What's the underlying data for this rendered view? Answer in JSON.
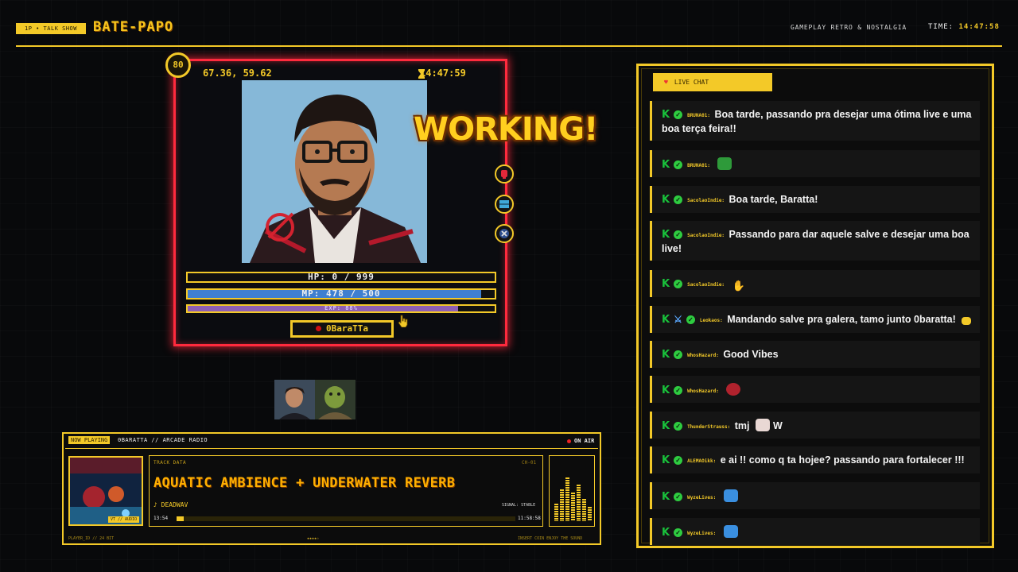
{
  "header": {
    "mode_tag": "1P • TALK SHOW",
    "title": "BATE-PAPO",
    "subtitle": "GAMEPLAY RETRO & NOSTALGIA",
    "time_label": "TIME:",
    "time_value": "14:47:58"
  },
  "card": {
    "level": "80",
    "coords": "67.36, 59.62",
    "clock": "14:47:59",
    "status_overlay": "WORKING!",
    "hp_label": "HP: 0 / 999",
    "hp_fraction": 0,
    "mp_label": "MP: 478 / 500",
    "mp_fraction": 0.956,
    "exp_label": "EXP: 88%",
    "exp_fraction": 0.88,
    "player_name": "0BaraTTa"
  },
  "radio": {
    "now_playing_tag": "NOW PLAYING",
    "station": "0BARATTA // ARCADE RADIO",
    "on_air": "ON AIR",
    "album_tag": "VT // AUDIO",
    "track_data_label": "TRACK DATA",
    "channel": "CH-01",
    "track_title": "AQUATIC AMBIENCE + UNDERWATER REVERB",
    "artist": "♪ DEADWAV",
    "signal": "SIGNAL: STABLE",
    "time_start": "13:54",
    "time_end": "11:58:58",
    "progress_fraction": 0.02,
    "footer_left": "PLAYER_ID // 24 BIT",
    "footer_center": "★★★★☆",
    "footer_right": "INSERT COIN   ENJOY THE SOUND"
  },
  "chat": {
    "header": "LIVE CHAT",
    "messages": [
      {
        "user": "BRUNA01:",
        "text": "Boa tarde, passando pra desejar uma ótima live e uma boa terça feira!!",
        "emote": ""
      },
      {
        "user": "BRUNA01:",
        "text": "",
        "emote": "frog"
      },
      {
        "user": "SacolaoIndie:",
        "text": "Boa tarde, Baratta!",
        "emote": ""
      },
      {
        "user": "SacolaoIndie:",
        "text": "Passando para dar aquele salve e desejar uma boa live!",
        "emote": ""
      },
      {
        "user": "SacolaoIndie:",
        "text": "",
        "emote": "clap"
      },
      {
        "user": "Leokaos:",
        "text": "Mandando salve pra galera, tamo junto 0baratta!",
        "emote": "wave"
      },
      {
        "user": "WhosHazard:",
        "text": "Good Vibes",
        "emote": ""
      },
      {
        "user": "WhosHazard:",
        "text": "",
        "emote": "heart-face"
      },
      {
        "user": "ThunderStrauss:",
        "text": "tmj",
        "emote": "W"
      },
      {
        "user": "ALEMAOikk:",
        "text": "e ai !! como q ta hojee? passando para fortalecer !!!",
        "emote": ""
      },
      {
        "user": "WyzeLives:",
        "text": "",
        "emote": "cat"
      },
      {
        "user": "WyzeLives:",
        "text": "",
        "emote": "cat"
      }
    ]
  },
  "colors": {
    "accent": "#f3c928",
    "card_border": "#ff2a3d",
    "mp_bar": "#3f7fd0",
    "exp_bar": "#8e5fb5",
    "verified": "#2ecc40"
  }
}
